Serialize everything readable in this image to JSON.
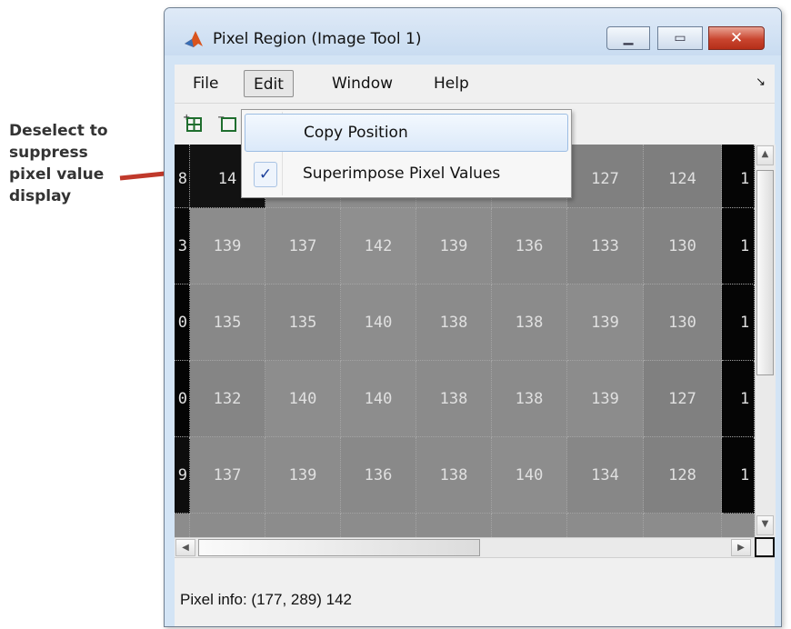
{
  "callout": {
    "text": "Deselect to\nsuppress\npixel value\ndisplay",
    "color": "#333333",
    "arrow_color": "#c0392b"
  },
  "window": {
    "title": "Pixel Region (Image Tool 1)",
    "controls": {
      "minimize": "minimize-icon",
      "maximize": "maximize-icon",
      "close": "close-icon"
    }
  },
  "menubar": {
    "file": "File",
    "edit": "Edit",
    "window": "Window",
    "help": "Help",
    "dock_arrow": "↘"
  },
  "edit_menu": {
    "items": [
      {
        "label": "Copy Position",
        "checked": false
      },
      {
        "label": "Superimpose Pixel Values",
        "checked": true
      }
    ],
    "check_glyph": "✓"
  },
  "toolbar": {
    "icons": [
      "expand-range-icon",
      "contract-range-icon"
    ]
  },
  "pixel_grid": {
    "rows": [
      [
        "8",
        "14",
        "",
        "",
        "",
        "",
        "127",
        "124",
        "1"
      ],
      [
        "3",
        "139",
        "137",
        "142",
        "139",
        "136",
        "133",
        "130",
        "1"
      ],
      [
        "0",
        "135",
        "135",
        "140",
        "138",
        "138",
        "139",
        "130",
        "1"
      ],
      [
        "0",
        "132",
        "140",
        "140",
        "138",
        "138",
        "139",
        "127",
        "1"
      ],
      [
        "9",
        "137",
        "139",
        "136",
        "138",
        "140",
        "134",
        "128",
        "1"
      ],
      [
        "",
        "",
        "",
        "",
        "",
        "",
        "",
        "",
        ""
      ]
    ]
  },
  "status": {
    "pixel_info": "Pixel info: (177, 289)  142"
  },
  "colors": {
    "window_frame": "#d3e4f5",
    "chrome": "#f0f0f0",
    "close_button": "#c9452f",
    "menu_highlight": "#dbe9f9"
  }
}
